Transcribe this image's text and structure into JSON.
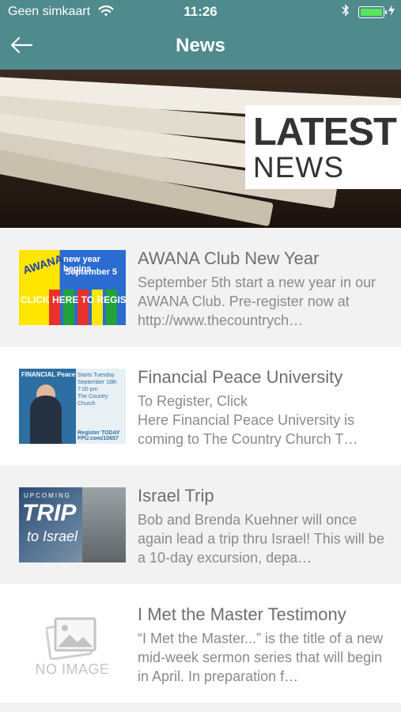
{
  "status_bar": {
    "carrier": "Geen simkaart",
    "time": "11:26",
    "battery_level": 1.0,
    "battery_color": "#57e65a"
  },
  "nav": {
    "title": "News",
    "back_icon": "arrow-left-icon"
  },
  "hero": {
    "line1": "LATEST",
    "line2": "NEWS"
  },
  "news_items": [
    {
      "title": "AWANA Club New Year",
      "description": "September 5th start a new year in our AWANA Club.  Pre-register now at http://www.thecountrych…",
      "thumbnail": {
        "brand": "AWANA",
        "line1": "new year begins",
        "line2": "September 5",
        "line3": "CLICK HERE TO REGISTER TODAY"
      }
    },
    {
      "title": "Financial Peace University",
      "description": "                To Register, Click\nHere  Financial Peace University is coming to The Country Church T…",
      "thumbnail": {
        "brand": "FINANCIAL Peace",
        "line1": "Starts Tuesday",
        "line2": "September 18th",
        "line3": "7:00 pm",
        "line4": "The Country Church",
        "line5": "Register TODAY",
        "line6": "FPU.com/10657"
      }
    },
    {
      "title": "Israel Trip",
      "description": "Bob and Brenda Kuehner will once again lead a trip thru Israel! This will be a 10-day excursion, depa…",
      "thumbnail": {
        "line1": "UPCOMING",
        "line2": "TRIP",
        "line3": "to Israel"
      }
    },
    {
      "title": "I Met the Master Testimony",
      "description": "“I Met the Master...” is the title of a new mid-week sermon series that will begin in April. In preparation f…",
      "thumbnail": {
        "placeholder_text": "NO IMAGE",
        "icon": "image-placeholder-icon"
      }
    }
  ],
  "colors": {
    "header": "#4f8a8d",
    "title_text": "#6e6e6e",
    "desc_text": "#8a8a8a"
  }
}
